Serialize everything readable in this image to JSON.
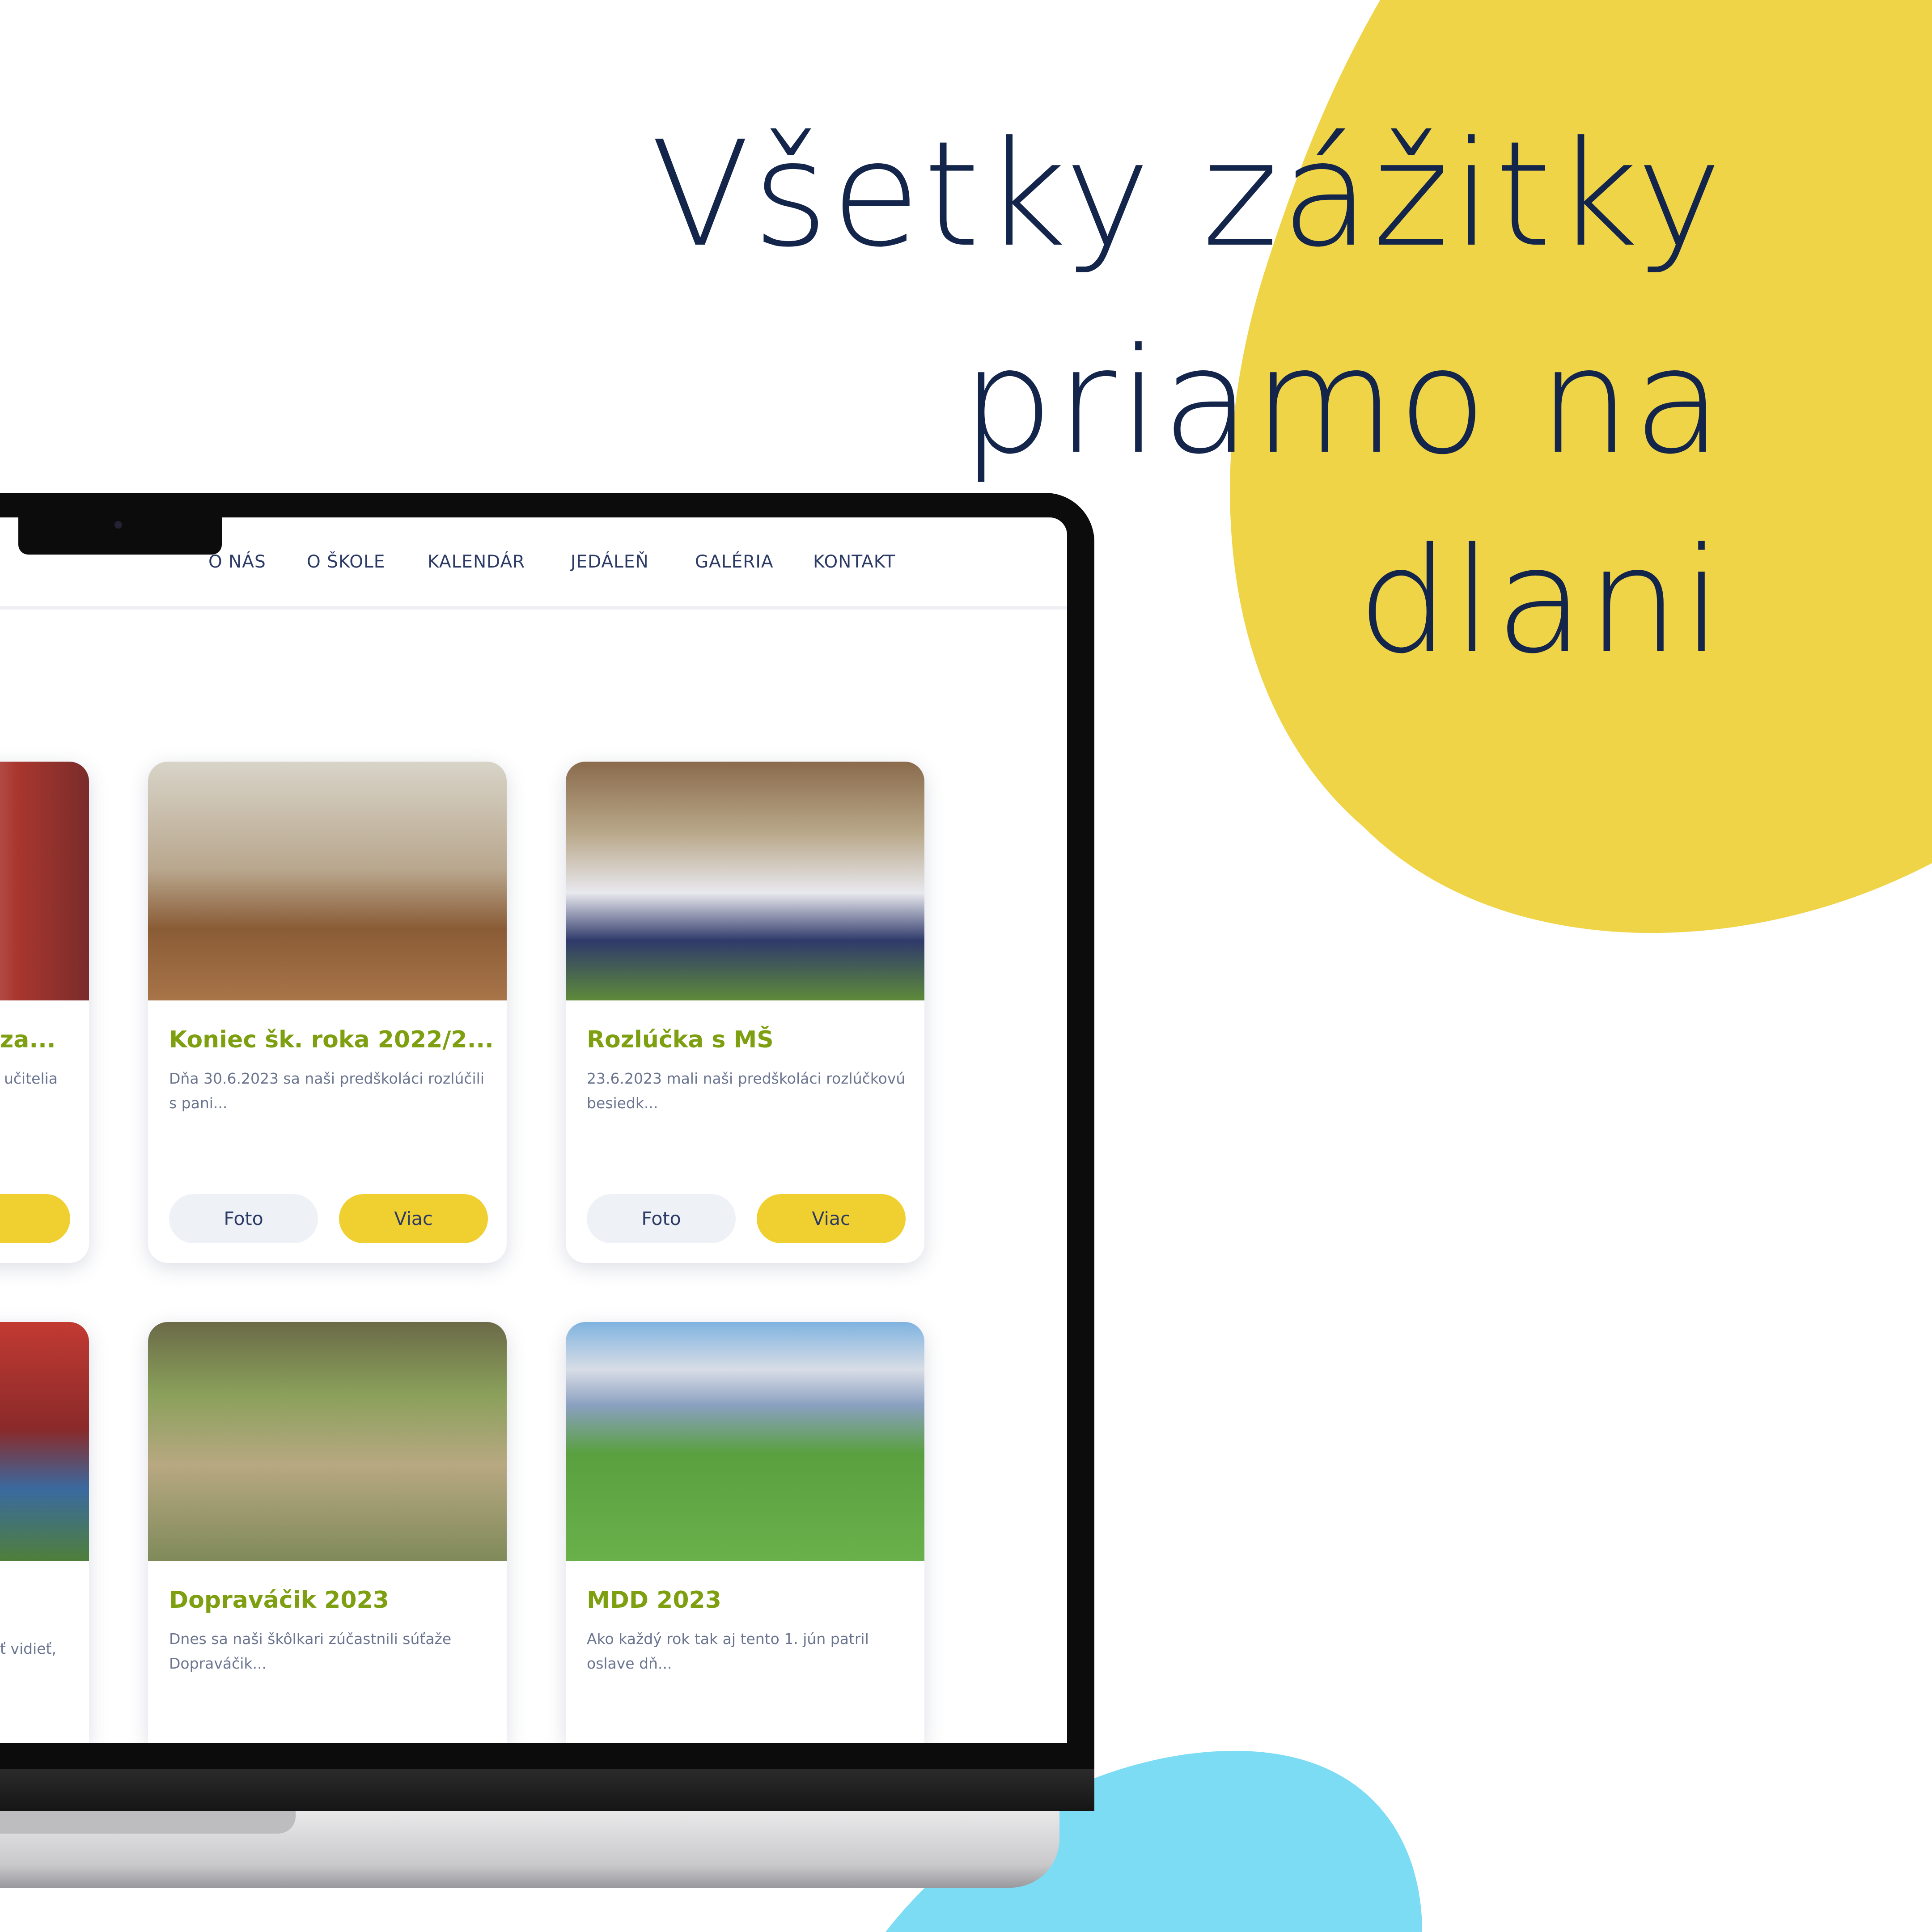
{
  "headline": {
    "line1": "Všetky zážitky",
    "line2": "priamo na",
    "line3": "dlani"
  },
  "colors": {
    "yellow_blob": "#f0d447",
    "blue_blob": "#7bdcf3",
    "headline": "#13254a",
    "card_title": "#7e9f10",
    "viac_button": "#f0d030",
    "foto_button": "#eef1f6"
  },
  "nav": {
    "items": [
      "O NÁS",
      "O ŠKOLE",
      "KALENDÁR",
      "JEDÁLEŇ",
      "GALÉRIA",
      "KONTAKT"
    ]
  },
  "cards": [
    {
      "title": "za...",
      "desc": "učitelia",
      "foto": "",
      "viac": ""
    },
    {
      "title": "Koniec šk. roka 2022/2...",
      "desc": "Dňa 30.6.2023 sa naši predškoláci rozlúčili s pani...",
      "foto": "Foto",
      "viac": "Viac"
    },
    {
      "title": "Rozlúčka s MŠ",
      "desc": "23.6.2023 mali naši predškoláci rozlúčkovú besiedk...",
      "foto": "Foto",
      "viac": "Viac"
    },
    {
      "title": "",
      "desc": "ť vidieť,"
    },
    {
      "title": "Dopraváčik 2023",
      "desc": "Dnes sa naši škôlkari zúčastnili súťaže Dopraváčik..."
    },
    {
      "title": "MDD 2023",
      "desc": "Ako každý rok tak aj tento 1. jún patril oslave dň..."
    }
  ]
}
